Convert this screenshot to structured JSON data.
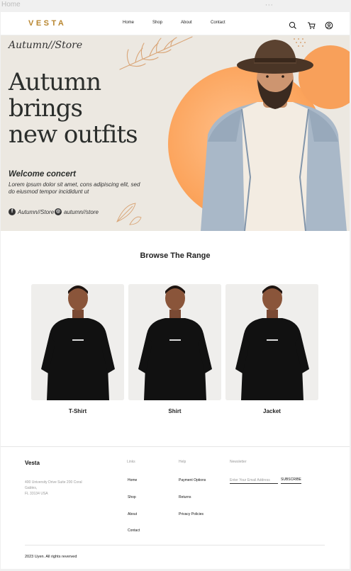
{
  "frame": {
    "label": "Home",
    "dots": "···"
  },
  "header": {
    "logo": "VESTA",
    "nav": [
      {
        "label": "Home"
      },
      {
        "label": "Shop"
      },
      {
        "label": "About"
      },
      {
        "label": "Contact"
      }
    ],
    "icons": [
      "search-icon",
      "cart-icon",
      "account-icon"
    ]
  },
  "hero": {
    "script_title": "Autumn//Store",
    "headline_lines": [
      "Autumn",
      "brings",
      "new outfits"
    ],
    "subheading": "Welcome concert",
    "paragraph": "Lorem ipsum dolor sit amet, cons adipiscing elit, sed do eiusmod tempor incididunt ut",
    "social": [
      {
        "icon": "facebook-icon",
        "handle": "Autumn//Store"
      },
      {
        "icon": "instagram-icon",
        "handle": "autumn//store"
      }
    ],
    "accent_color": "#f9923f"
  },
  "browse": {
    "title": "Browse The Range",
    "products": [
      {
        "label": "T-Shirt"
      },
      {
        "label": "Shirt"
      },
      {
        "label": "Jacket"
      }
    ]
  },
  "footer": {
    "brand": "Vesta",
    "address_lines": [
      "400 University Drive Suite 200 Coral",
      "Gables,",
      "FL 33134 USA"
    ],
    "links_heading": "Links",
    "links": [
      "Home",
      "Shop",
      "About",
      "Contact"
    ],
    "help_heading": "Help",
    "help": [
      "Payment Options",
      "Returns",
      "Privacy Policies"
    ],
    "newsletter_heading": "Newsletter",
    "newsletter_placeholder": "Enter Your Email Address",
    "subscribe_label": "SUBSCRIBE",
    "copyright": "2023 Uyen. All rights reverved"
  }
}
